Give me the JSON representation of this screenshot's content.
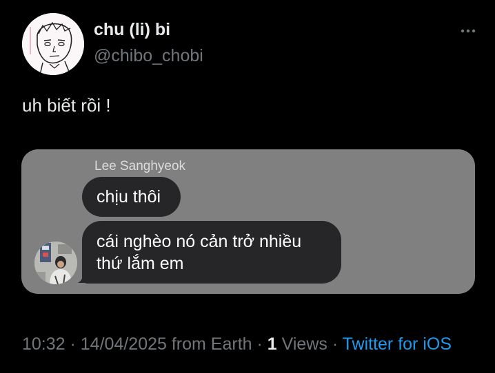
{
  "author": {
    "display_name": "chu (li) bi",
    "handle": "@chibo_chobi",
    "avatar_icon": "avatar-drawing-icon"
  },
  "tweet": {
    "text": "uh biết rồi !"
  },
  "chat_screenshot": {
    "sender_name": "Lee Sanghyeok",
    "messages": [
      {
        "lines": [
          "chịu thôi"
        ]
      },
      {
        "lines": [
          "cái nghèo nó cản trở nhiều",
          "thứ lắm em"
        ]
      }
    ],
    "avatar_icon": "sender-avatar-icon"
  },
  "meta": {
    "time": "10:32",
    "sep1": " · ",
    "date": "14/04/2025",
    "location": " from Earth",
    "sep2": " · ",
    "views_count": "1",
    "views_label": " Views",
    "sep3": " · ",
    "source": "Twitter for iOS"
  },
  "colors": {
    "background": "#000000",
    "primary_text": "#e7e9ea",
    "secondary_text": "#71767b",
    "link": "#1d9bf0",
    "card_background": "#808080",
    "bubble_background": "#262628"
  }
}
